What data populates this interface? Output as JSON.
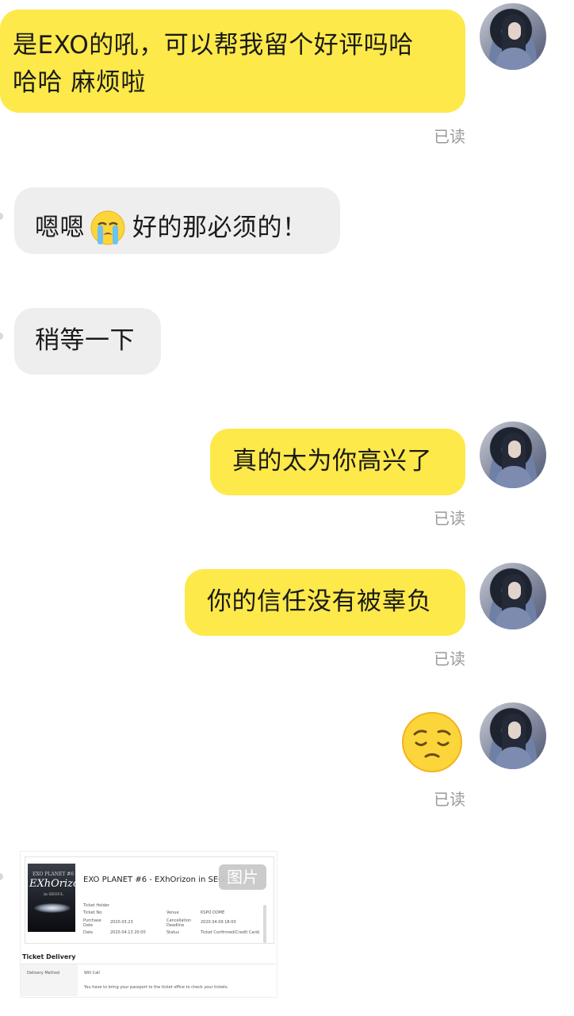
{
  "messages": [
    {
      "text_line1": "是EXO的吼，可以帮我留个好评吗哈",
      "text_line2": "哈哈 麻烦啦",
      "read": "已读"
    },
    {
      "text_before_emoji": "嗯嗯",
      "emoji": "loudly-crying-face",
      "text_after_emoji": " 好的那必须的！"
    },
    {
      "text": "稍等一下"
    },
    {
      "text": "真的太为你高兴了",
      "read": "已读"
    },
    {
      "text": "你的信任没有被辜负",
      "read": "已读"
    },
    {
      "emoji": "pensive-face",
      "read": "已读"
    }
  ],
  "ticket": {
    "badge": "图片",
    "title": "EXO PLANET #6 - EXhOrizon in SEOUL",
    "poster": {
      "line1": "EXO PLANET #6",
      "line2": "EXhOrizon",
      "line3": "in SEOUL"
    },
    "fields": {
      "ticket_holder": "Ticket Holder",
      "ticket_no": "Ticket No.",
      "purchase_date_label": "Purchase Date",
      "purchase_date_value": "2020.03.23",
      "date_label": "Date",
      "date_value": "2020.04.13 20:00",
      "venue_label": "Venue",
      "venue_value": "KSPO DOME",
      "cancellation_label": "Cancellation Deadline",
      "cancellation_value": "2020.04.09 18:00",
      "status_label": "Status",
      "status_value": "Ticket Confirmed(Credit Card)"
    },
    "delivery": {
      "heading": "Ticket Delivery",
      "method_label": "Delivery Method",
      "method_value": "Will Call",
      "note": "You have to bring your passport to the ticket office to check your tickets."
    }
  },
  "colors": {
    "mine_bubble": "#fde94a",
    "theirs_bubble": "#eeeeee",
    "read_text": "#9a9a9a"
  }
}
